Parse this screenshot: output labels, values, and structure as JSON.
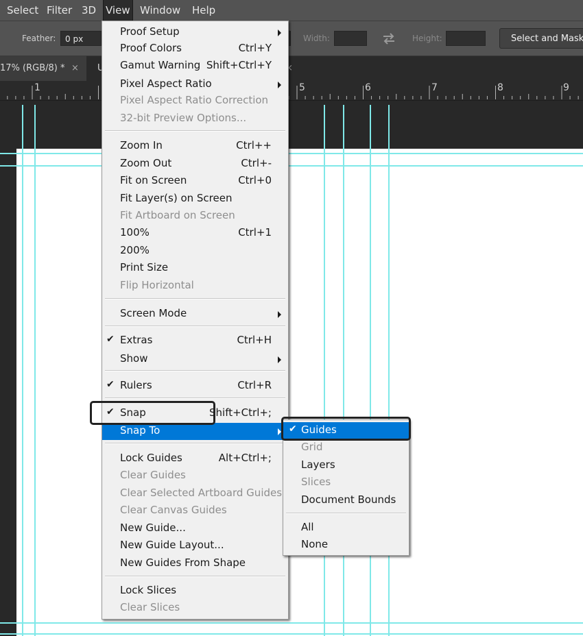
{
  "menubar": {
    "items": [
      "Select",
      "Filter",
      "3D",
      "View",
      "Window",
      "Help"
    ]
  },
  "options": {
    "feather_label": "Feather:",
    "feather_value": "0 px",
    "width_label": "Width:",
    "height_label": "Height:",
    "select_mask_label": "Select and Mask..."
  },
  "tabs": {
    "doc_tab_label": "17% (RGB/8) *",
    "doc_tab_close": "×",
    "second_tab_fragment": "U",
    "second_tab_close": "×"
  },
  "ruler": {
    "numbers": [
      "1",
      "5",
      "6",
      "7",
      "8",
      "9"
    ]
  },
  "view_menu": {
    "items": [
      {
        "label": "Proof Setup",
        "submenu": true
      },
      {
        "label": "Proof Colors",
        "shortcut": "Ctrl+Y"
      },
      {
        "label": "Gamut Warning",
        "shortcut": "Shift+Ctrl+Y"
      },
      {
        "label": "Pixel Aspect Ratio",
        "submenu": true
      },
      {
        "label": "Pixel Aspect Ratio Correction",
        "disabled": true
      },
      {
        "label": "32-bit Preview Options...",
        "disabled": true
      },
      {
        "label": "Zoom In",
        "shortcut": "Ctrl++"
      },
      {
        "label": "Zoom Out",
        "shortcut": "Ctrl+-"
      },
      {
        "label": "Fit on Screen",
        "shortcut": "Ctrl+0"
      },
      {
        "label": "Fit Layer(s) on Screen"
      },
      {
        "label": "Fit Artboard on Screen",
        "disabled": true
      },
      {
        "label": "100%",
        "shortcut": "Ctrl+1"
      },
      {
        "label": "200%"
      },
      {
        "label": "Print Size"
      },
      {
        "label": "Flip Horizontal",
        "disabled": true
      },
      {
        "label": "Screen Mode",
        "submenu": true
      },
      {
        "label": "Extras",
        "shortcut": "Ctrl+H",
        "checked": true
      },
      {
        "label": "Show",
        "submenu": true
      },
      {
        "label": "Rulers",
        "shortcut": "Ctrl+R",
        "checked": true
      },
      {
        "label": "Snap",
        "shortcut": "Shift+Ctrl+;",
        "checked": true
      },
      {
        "label": "Snap To",
        "submenu": true,
        "highlighted": true
      },
      {
        "label": "Lock Guides",
        "shortcut": "Alt+Ctrl+;"
      },
      {
        "label": "Clear Guides",
        "disabled": true
      },
      {
        "label": "Clear Selected Artboard Guides",
        "disabled": true
      },
      {
        "label": "Clear Canvas Guides",
        "disabled": true
      },
      {
        "label": "New Guide..."
      },
      {
        "label": "New Guide Layout..."
      },
      {
        "label": "New Guides From Shape"
      },
      {
        "label": "Lock Slices"
      },
      {
        "label": "Clear Slices",
        "disabled": true
      }
    ]
  },
  "snap_to_menu": {
    "items": [
      {
        "label": "Guides",
        "checked": true,
        "highlighted": true
      },
      {
        "label": "Grid",
        "disabled": true
      },
      {
        "label": "Layers"
      },
      {
        "label": "Slices",
        "disabled": true
      },
      {
        "label": "Document Bounds"
      },
      {
        "label": "All"
      },
      {
        "label": "None"
      }
    ]
  },
  "glyphs": {
    "check": "✔"
  },
  "colors": {
    "menu_highlight": "#0078d7",
    "guide": "#7fe8e8",
    "menu_bg": "#f0f0f0",
    "ui_chrome": "#535353"
  },
  "icons": {
    "swap": "swap-arrows-icon",
    "submenu_arrow": "chevron-right-icon",
    "check": "checkmark-icon"
  }
}
